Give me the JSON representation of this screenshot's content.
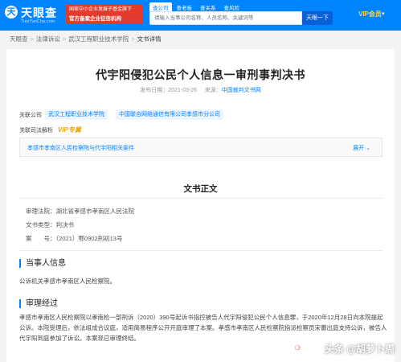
{
  "header": {
    "logo_icon": "天",
    "logo_text": "天眼查",
    "logo_sub": "TianYanCha.com",
    "promo_line1": "国家中小企业发展子基金旗下",
    "promo_line2": "官方备案企业征信机构",
    "search_tabs": [
      "查公司",
      "查老板",
      "查关系",
      "查风险"
    ],
    "search_placeholder": "请输入当事公司名称、人员名称、关键词等",
    "search_button": "天眼一下",
    "vip_label": "VIP会员"
  },
  "breadcrumb": [
    "天眼查",
    "法律诉讼",
    "武汉工程职业技术学院",
    "文书详情"
  ],
  "document": {
    "title": "代宇阳侵犯公民个人信息一审刑事判决书",
    "publish_label": "发布日期：",
    "publish_date": "2021-03-26",
    "source_label": "来源：",
    "source": "中国裁判文书网",
    "related_label": "关联公司",
    "companies": [
      "武汉工程职业技术学院",
      "中国联合网络通信有限公司孝感市分公司"
    ],
    "analysis_label": "关联司法解析",
    "vip_badge": "VIP专属",
    "case_link": "孝感市孝南区人民检察院与代宇阳相关案件",
    "expand_label": "展开"
  },
  "body": {
    "section_title": "文书正文",
    "court": "审理法院：湖北省孝感市孝南区人民法院",
    "doc_type": "文书类型：判决书",
    "case_no": "案　　号：（2021）鄂0902刑初13号",
    "parties_title": "当事人信息",
    "parties_text": "公诉机关孝感市孝南区人民检察院。",
    "trial_title": "审理经过",
    "trial_text": "孝感市孝南区人民检察院以孝南检一部刑诉（2020）390号起诉书指控被告人代宇阳侵犯公民个人信息罪，于2020年12月28日向本院提起公诉。本院受理后，依法组成合议庭，适用简易程序公开开庭审理了本案。孝感市孝南区人民检察院指派检察员宋蕾出庭支持公诉，被告人代宇阳到庭参加了诉讼。本案现已审理终结。"
  },
  "watermark": "头条 @胡萝卜周",
  "colors": {
    "brand": "#0084ff",
    "promo": "#e23b2e",
    "vip": "#e8a900"
  }
}
